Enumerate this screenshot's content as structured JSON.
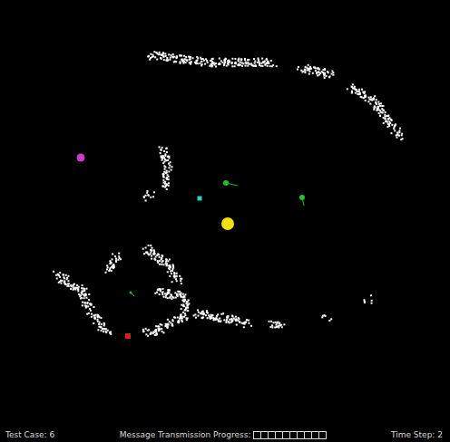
{
  "status_bar": {
    "test_case": "Test Case: 6",
    "progress_label": "Message Transmission Progress:",
    "progress_cells": [
      {
        "filled": false
      },
      {
        "filled": false
      },
      {
        "filled": false
      },
      {
        "filled": false
      },
      {
        "filled": false
      },
      {
        "filled": false
      },
      {
        "filled": false
      },
      {
        "filled": false
      },
      {
        "filled": false
      },
      {
        "filled": false
      }
    ],
    "time_step": "Time Step: 2"
  },
  "entities": [
    {
      "kind": "circle",
      "color": "#c83cc8"
    },
    {
      "kind": "agent",
      "color": "#22c02a"
    },
    {
      "kind": "agent",
      "color": "#22c02a"
    },
    {
      "kind": "agent",
      "color": "#22c02a"
    },
    {
      "kind": "square",
      "color": "#2ad0c8"
    },
    {
      "kind": "circle",
      "color": "#f0e010"
    },
    {
      "kind": "square",
      "color": "#d02020"
    }
  ]
}
